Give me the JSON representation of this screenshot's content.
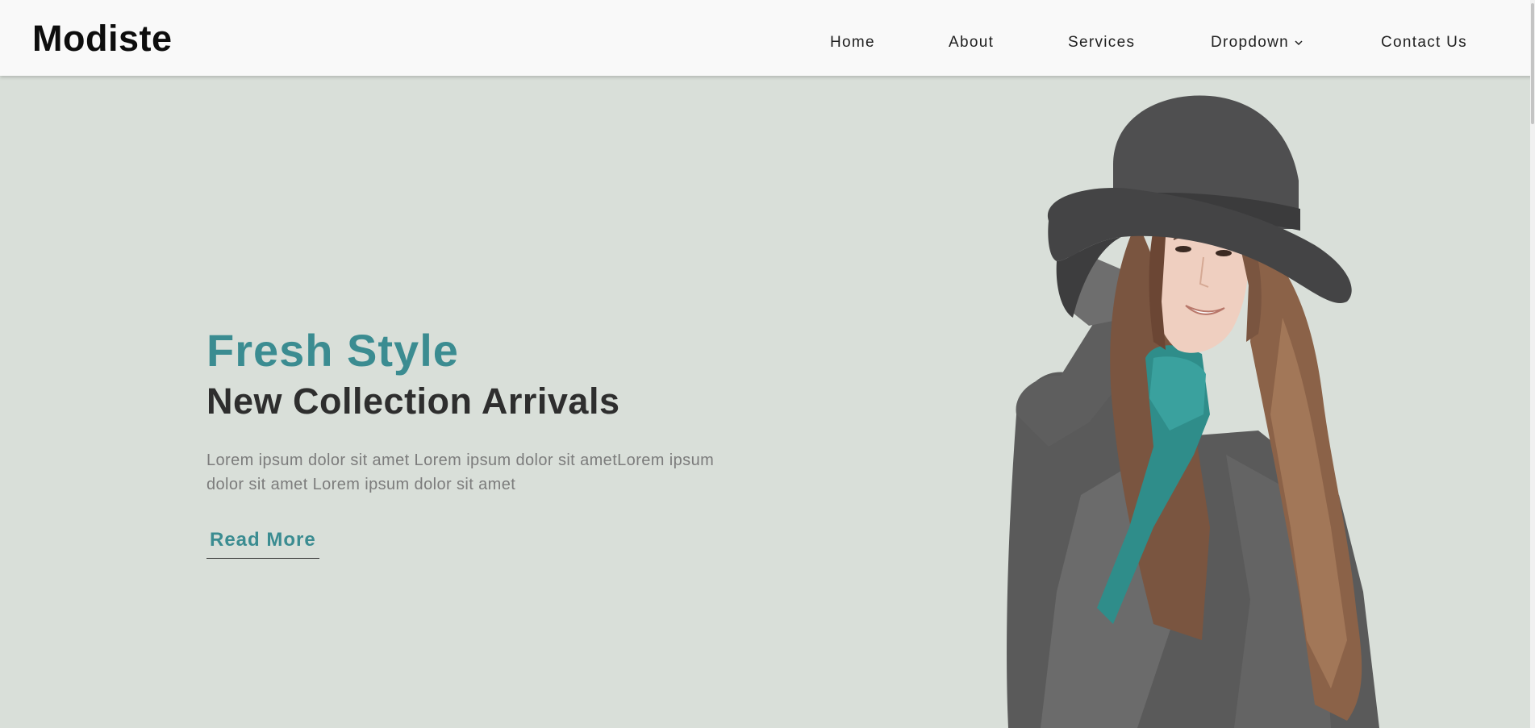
{
  "brand": "Modiste",
  "nav": {
    "home": "Home",
    "about": "About",
    "services": "Services",
    "dropdown": "Dropdown",
    "contact": "Contact Us"
  },
  "hero": {
    "title": "Fresh Style",
    "subtitle": "New Collection Arrivals",
    "text": "Lorem ipsum dolor sit amet Lorem ipsum dolor sit ametLorem ipsum dolor sit amet Lorem ipsum dolor sit amet",
    "button": "Read More",
    "image_icon": "model-woman-hat-image"
  },
  "colors": {
    "accent": "#3b8c91",
    "hero_bg": "#d9dfd9",
    "nav_bg": "#f9f9f9"
  }
}
